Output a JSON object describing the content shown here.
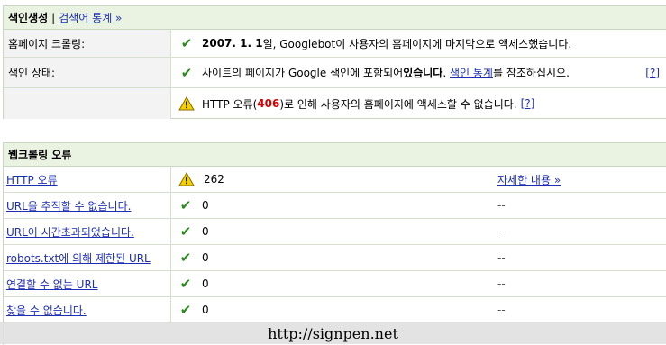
{
  "index_panel": {
    "title": "색인생성",
    "separator": "|",
    "stats_link": "검색어 통계 »",
    "rows": [
      {
        "label": "홈페이지 크롤링:",
        "date": "2007. 1. 1",
        "text": "일, Googlebot이 사용자의 홈페이지에 마지막으로 액세스했습니다."
      },
      {
        "label": "색인 상태:",
        "text_before": "사이트의 페이지가 Google 색인에 포함되어 ",
        "text_bold": "있습니다",
        "text_mid": ". ",
        "link": "색인 통계",
        "text_after": "를 참조하십시오.",
        "help": "[?]"
      },
      {
        "label": "",
        "text_before": "HTTP 오류(",
        "code": "406",
        "text_after": ")로 인해 사용자의 홈페이지에 액세스할 수 없습니다.",
        "help": "[?]"
      }
    ]
  },
  "crawl_panel": {
    "title": "웹크롤링 오류",
    "rows": [
      {
        "label": "HTTP 오류",
        "status": "warning",
        "count": "262",
        "detail": "자세한 내용 »"
      },
      {
        "label": "URL을 추적할 수 없습니다.",
        "status": "ok",
        "count": "0",
        "detail": "--"
      },
      {
        "label": "URL이 시간초과되었습니다.",
        "status": "ok",
        "count": "0",
        "detail": "--"
      },
      {
        "label": "robots.txt에 의해 제한된 URL",
        "status": "ok",
        "count": "0",
        "detail": "--"
      },
      {
        "label": "연결할 수 없는 URL",
        "status": "ok",
        "count": "0",
        "detail": "--"
      },
      {
        "label": "찾을 수 없습니다.",
        "status": "ok",
        "count": "0",
        "detail": "--"
      }
    ]
  },
  "footer": {
    "watermark": "http://signpen.net"
  },
  "colors": {
    "header_bg": "#eaf2e2",
    "link": "#1f2fb3",
    "ok": "#2b8a1e",
    "error_code": "#d10000"
  }
}
